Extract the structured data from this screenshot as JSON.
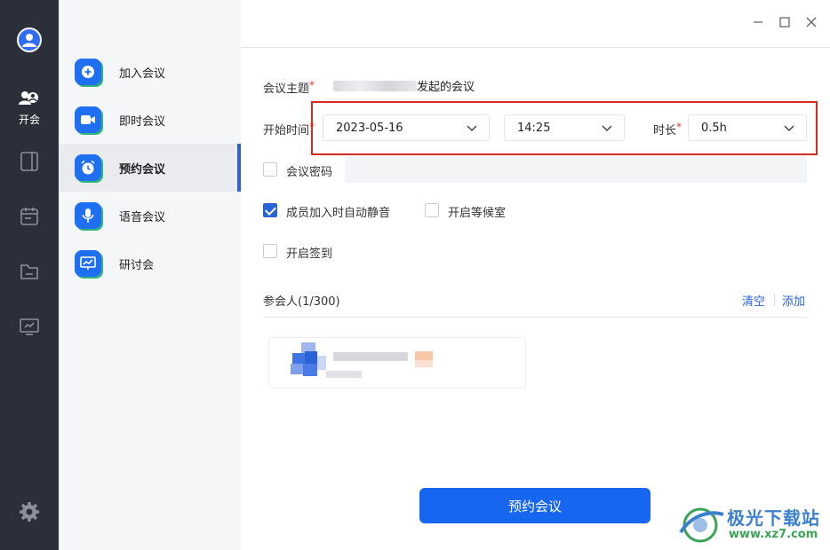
{
  "rail": {
    "items": [
      {
        "label": "开会",
        "icon": "people-icon"
      },
      {
        "label": "",
        "icon": "tablet-icon"
      },
      {
        "label": "",
        "icon": "calendar-icon"
      },
      {
        "label": "",
        "icon": "folder-icon"
      },
      {
        "label": "",
        "icon": "screen-icon"
      },
      {
        "label": "",
        "icon": "settings-icon"
      }
    ]
  },
  "meeting_types": [
    {
      "label": "加入会议",
      "icon": "plus-icon"
    },
    {
      "label": "即时会议",
      "icon": "video-icon"
    },
    {
      "label": "预约会议",
      "icon": "alarm-clock-icon",
      "active": true
    },
    {
      "label": "语音会议",
      "icon": "microphone-icon"
    },
    {
      "label": "研讨会",
      "icon": "presentation-icon"
    }
  ],
  "form": {
    "topic_label": "会议主题",
    "topic_value_suffix": "发起的会议",
    "start_label": "开始时间",
    "date_value": "2023-05-16",
    "time_value": "14:25",
    "duration_label": "时长",
    "duration_value": "0.5h",
    "required_mark": "*",
    "password_label": "会议密码",
    "mute_label": "成员加入时自动静音",
    "waiting_label": "开启等候室",
    "signin_label": "开启签到",
    "mute_checked": true,
    "waiting_checked": false,
    "signin_checked": false,
    "password_checked": false
  },
  "attendees": {
    "title": "参会人(1/300)",
    "clear_label": "清空",
    "add_label": "添加"
  },
  "submit_label": "预约会议",
  "watermark": {
    "title": "极光下载站",
    "url": "www.xz7.com"
  },
  "colors": {
    "accent": "#1766f2",
    "rail": "#2b2f3a",
    "highlight": "#d42a20"
  }
}
